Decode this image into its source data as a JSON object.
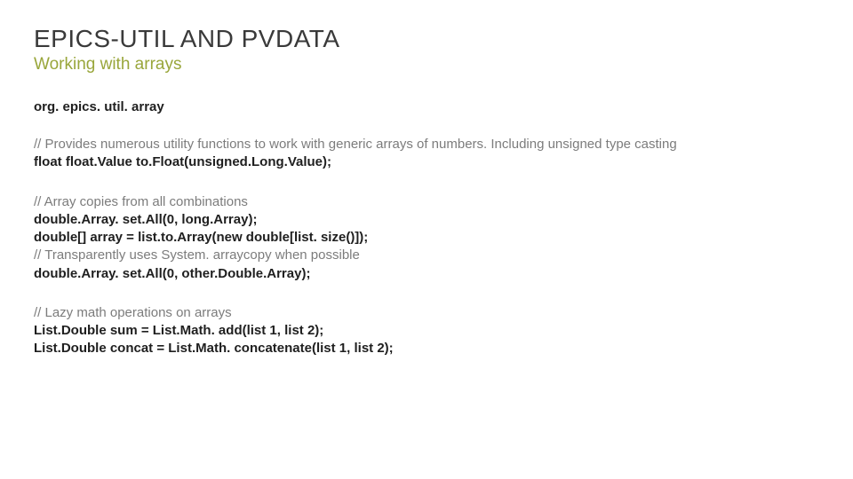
{
  "title": "EPICS-UTIL AND PVDATA",
  "subtitle": "Working with arrays",
  "package": "org. epics. util. array",
  "block1": {
    "comment1": "// Provides numerous utility functions to work with generic arrays of numbers. Including unsigned type casting",
    "code1": "float float.Value to.Float(unsigned.Long.Value);"
  },
  "block2": {
    "comment1": "// Array copies from all combinations",
    "code1": "double.Array. set.All(0, long.Array);",
    "code2": "double[] array = list.to.Array(new double[list. size()]);",
    "comment2": "// Transparently uses System. arraycopy when possible",
    "code3": "double.Array. set.All(0, other.Double.Array);"
  },
  "block3": {
    "comment1": "// Lazy math operations on arrays",
    "code1": "List.Double sum = List.Math. add(list 1, list 2);",
    "code2": "List.Double concat = List.Math. concatenate(list 1, list 2);"
  }
}
